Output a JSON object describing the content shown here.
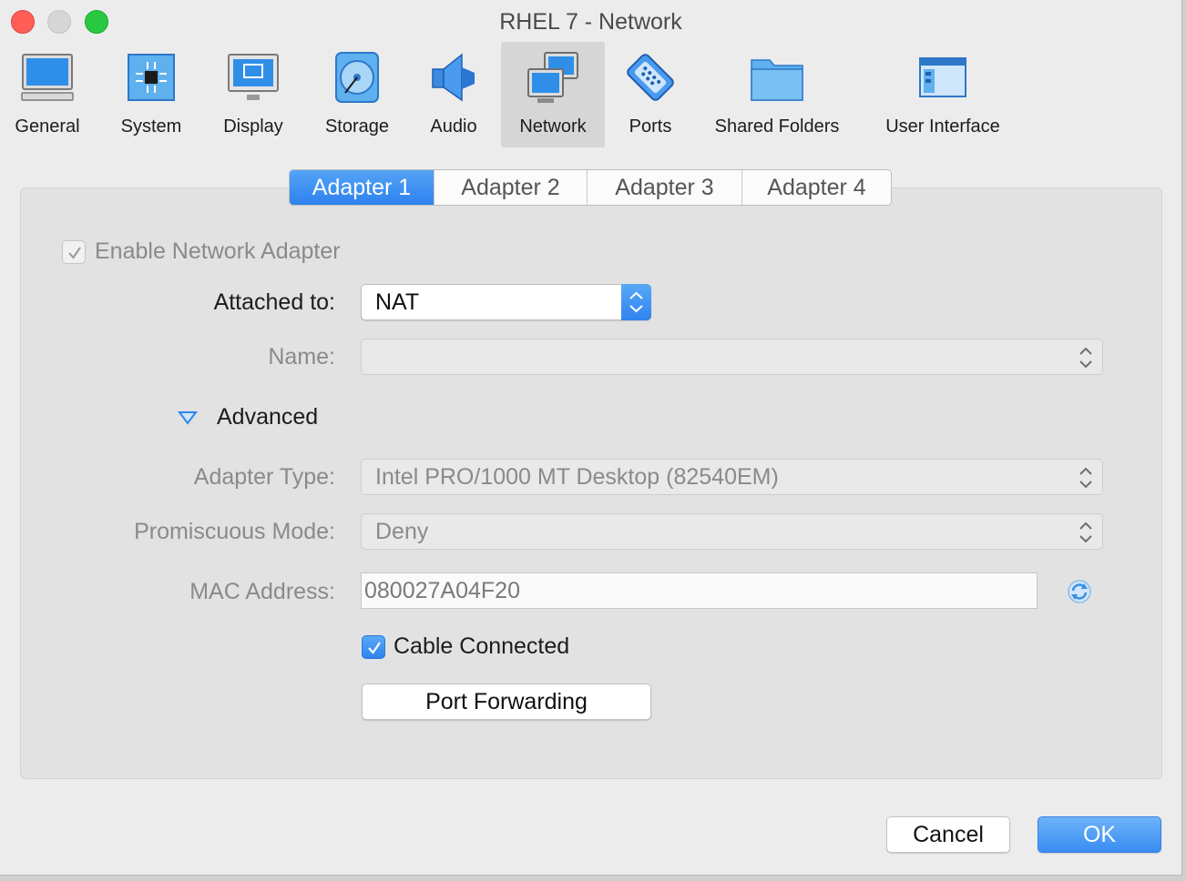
{
  "window": {
    "title": "RHEL 7 - Network"
  },
  "toolbar": {
    "items": [
      {
        "label": "General",
        "icon": "monitor-icon"
      },
      {
        "label": "System",
        "icon": "chip-icon"
      },
      {
        "label": "Display",
        "icon": "display-icon"
      },
      {
        "label": "Storage",
        "icon": "disk-icon"
      },
      {
        "label": "Audio",
        "icon": "speaker-icon"
      },
      {
        "label": "Network",
        "icon": "network-icon",
        "selected": true
      },
      {
        "label": "Ports",
        "icon": "serial-port-icon"
      },
      {
        "label": "Shared Folders",
        "icon": "folder-icon"
      },
      {
        "label": "User Interface",
        "icon": "window-icon"
      }
    ]
  },
  "tabs": [
    "Adapter 1",
    "Adapter 2",
    "Adapter 3",
    "Adapter 4"
  ],
  "active_tab": "Adapter 1",
  "form": {
    "enable_adapter": {
      "label": "Enable Network Adapter",
      "checked": true,
      "enabled": false
    },
    "attached_to": {
      "label": "Attached to:",
      "value": "NAT"
    },
    "name": {
      "label": "Name:",
      "value": ""
    },
    "advanced": {
      "label": "Advanced",
      "expanded": true
    },
    "adapter_type": {
      "label": "Adapter Type:",
      "value": "Intel PRO/1000 MT Desktop (82540EM)"
    },
    "promiscuous_mode": {
      "label": "Promiscuous Mode:",
      "value": "Deny"
    },
    "mac_address": {
      "label": "MAC Address:",
      "value": "080027A04F20"
    },
    "cable_connected": {
      "label": "Cable Connected",
      "checked": true
    },
    "port_forwarding": {
      "label": "Port Forwarding"
    }
  },
  "buttons": {
    "cancel": "Cancel",
    "ok": "OK"
  },
  "colors": {
    "accent": "#2f84ef",
    "close": "#ff5f57",
    "maximize": "#28c840"
  }
}
